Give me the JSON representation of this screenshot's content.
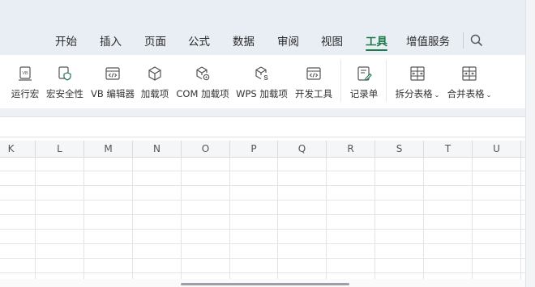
{
  "menu_tabs": [
    {
      "label": "开始",
      "active": false
    },
    {
      "label": "插入",
      "active": false
    },
    {
      "label": "页面",
      "active": false
    },
    {
      "label": "公式",
      "active": false
    },
    {
      "label": "数据",
      "active": false
    },
    {
      "label": "审阅",
      "active": false
    },
    {
      "label": "视图",
      "active": false
    },
    {
      "label": "工具",
      "active": true
    },
    {
      "label": "增值服务",
      "active": false
    }
  ],
  "search": {
    "icon": "search-icon"
  },
  "toolbar": {
    "items": [
      {
        "label": "运行宏",
        "icon": "run-macro-icon"
      },
      {
        "label": "宏安全性",
        "icon": "macro-security-icon"
      },
      {
        "label": "VB 编辑器",
        "icon": "vb-editor-icon"
      },
      {
        "label": "加载项",
        "icon": "addins-icon"
      },
      {
        "label": "COM 加载项",
        "icon": "com-addins-icon"
      },
      {
        "label": "WPS 加载项",
        "icon": "wps-addins-icon"
      },
      {
        "label": "开发工具",
        "icon": "developer-tools-icon"
      },
      {
        "label": "记录单",
        "icon": "record-form-icon"
      },
      {
        "label": "拆分表格",
        "icon": "split-table-icon",
        "dropdown": true
      },
      {
        "label": "合并表格",
        "icon": "merge-table-icon",
        "dropdown": true
      }
    ]
  },
  "columns": [
    "K",
    "L",
    "M",
    "N",
    "O",
    "P",
    "Q",
    "R",
    "S",
    "T",
    "U"
  ],
  "colors": {
    "accent": "#1e7a4a",
    "titlebar": "#e9eef4",
    "grid": "#e2e4e6"
  }
}
